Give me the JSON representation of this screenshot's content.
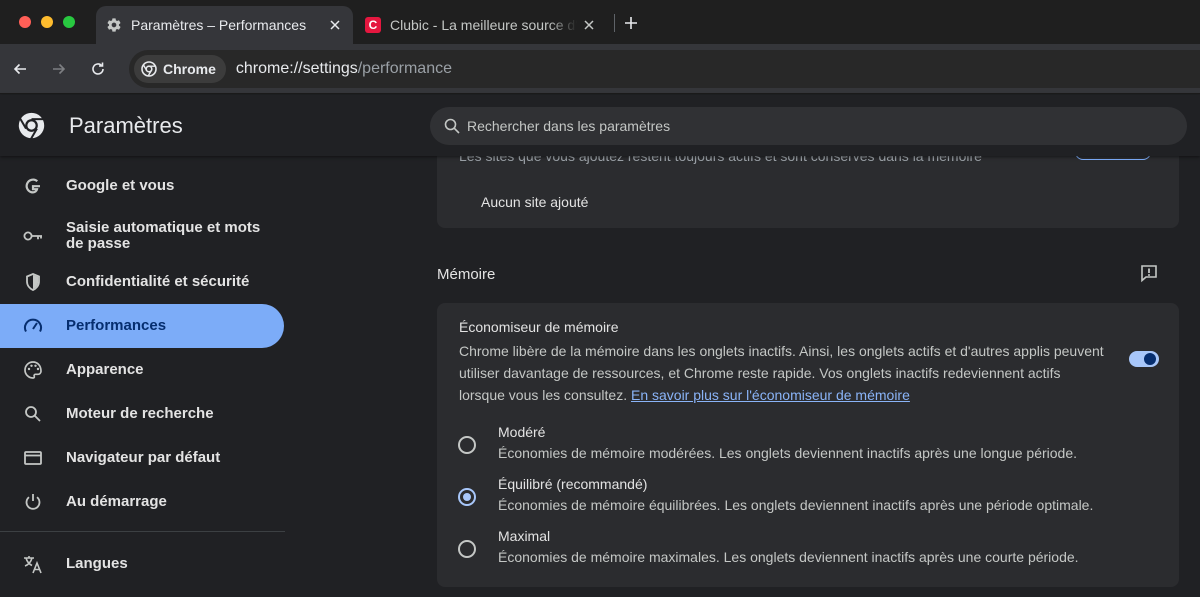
{
  "tabs": [
    {
      "title": "Paramètres – Performances",
      "icon": "gear-icon",
      "active": true
    },
    {
      "title": "Clubic - La meilleure source d'information",
      "icon": "clubic-logo",
      "active": false
    }
  ],
  "toolbar": {
    "chip_label": "Chrome",
    "url_host": "chrome://settings",
    "url_path": "/performance"
  },
  "header": {
    "title": "Paramètres",
    "search_placeholder": "Rechercher dans les paramètres"
  },
  "sidebar": {
    "items": [
      {
        "label": "Google et vous",
        "icon": "google-g-icon"
      },
      {
        "label": "Saisie automatique et mots de passe",
        "icon": "key-icon"
      },
      {
        "label": "Confidentialité et sécurité",
        "icon": "shield-icon"
      },
      {
        "label": "Performances",
        "icon": "speedometer-icon",
        "selected": true
      },
      {
        "label": "Apparence",
        "icon": "palette-icon"
      },
      {
        "label": "Moteur de recherche",
        "icon": "search-icon"
      },
      {
        "label": "Navigateur par défaut",
        "icon": "browser-window-icon"
      },
      {
        "label": "Au démarrage",
        "icon": "power-icon"
      },
      {
        "label": "Langues",
        "icon": "translate-icon"
      }
    ]
  },
  "main": {
    "cut_text": "Les sites que vous ajoutez restent toujours actifs et sont conservés dans la mémoire",
    "no_site": "Aucun site ajouté",
    "section_title": "Mémoire",
    "memory_saver": {
      "title": "Économiseur de mémoire",
      "description": "Chrome libère de la mémoire dans les onglets inactifs. Ainsi, les onglets actifs et d'autres applis peuvent utiliser davantage de ressources, et Chrome reste rapide. Vos onglets inactifs redeviennent actifs lorsque vous les consultez.",
      "link": "En savoir plus sur l'économiseur de mémoire",
      "enabled": true
    },
    "options": [
      {
        "label": "Modéré",
        "description": "Économies de mémoire modérées. Les onglets deviennent inactifs après une longue période.",
        "checked": false
      },
      {
        "label": "Équilibré (recommandé)",
        "description": "Économies de mémoire équilibrées. Les onglets deviennent inactifs après une période optimale.",
        "checked": true
      },
      {
        "label": "Maximal",
        "description": "Économies de mémoire maximales. Les onglets deviennent inactifs après une courte période.",
        "checked": false
      }
    ]
  },
  "colors": {
    "accent": "#7cacf8",
    "link": "#8ab4f8",
    "background": "#202124",
    "card": "#2b2c2f"
  }
}
